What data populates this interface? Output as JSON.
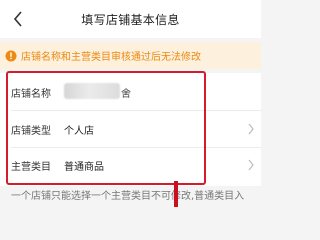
{
  "header": {
    "title": "填写店铺基本信息",
    "back_icon": "chevron-left-icon"
  },
  "notice": {
    "icon": "warning-circle-icon",
    "text": "店铺名称和主营类目审核通过后无法修改",
    "color": "#ec8a12",
    "background": "#fdf0dc"
  },
  "form": {
    "store_name": {
      "label": "店铺名称",
      "value_tail": "舍"
    },
    "store_type": {
      "label": "店铺类型",
      "value": "个人店"
    },
    "main_category": {
      "label": "主营类目",
      "value": "普通商品"
    }
  },
  "footer": {
    "text": "一个店铺只能选择一个主营类目不可修改,普通类目入"
  },
  "colors": {
    "highlight_border": "#d41c2c",
    "accent": "#ec8a12"
  }
}
